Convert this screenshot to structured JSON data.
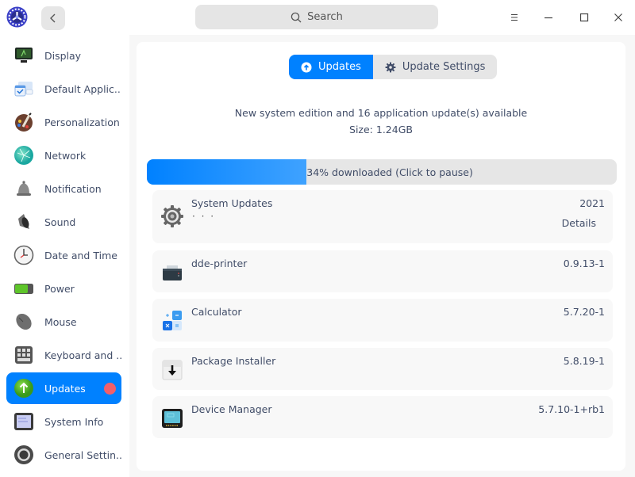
{
  "titlebar": {
    "app_icon": "deepin-control-center-logo-icon",
    "back_icon": "chevron-left-icon",
    "search_placeholder": "Search",
    "search_icon": "search-icon",
    "controls": [
      "menu-icon",
      "minimize-icon",
      "maximize-icon",
      "close-icon"
    ]
  },
  "sidebar": {
    "items": [
      {
        "label": "Display",
        "icon": "display-icon"
      },
      {
        "label": "Default Applic...",
        "icon": "default-applications-icon"
      },
      {
        "label": "Personalization",
        "icon": "personalization-palette-icon"
      },
      {
        "label": "Network",
        "icon": "network-globe-icon"
      },
      {
        "label": "Notification",
        "icon": "notification-bell-icon"
      },
      {
        "label": "Sound",
        "icon": "sound-speaker-icon"
      },
      {
        "label": "Date and Time",
        "icon": "clock-icon"
      },
      {
        "label": "Power",
        "icon": "battery-icon"
      },
      {
        "label": "Mouse",
        "icon": "mouse-icon"
      },
      {
        "label": "Keyboard and ...",
        "icon": "keyboard-icon"
      },
      {
        "label": "Updates",
        "icon": "update-arrow-icon",
        "active": true,
        "badge": true
      },
      {
        "label": "System Info",
        "icon": "system-info-icon"
      },
      {
        "label": "General Settin...",
        "icon": "general-settings-icon"
      }
    ]
  },
  "main": {
    "tabs": [
      {
        "label": "Updates",
        "icon": "upload-circle-icon",
        "active": true
      },
      {
        "label": "Update Settings",
        "icon": "gear-icon",
        "active": false
      }
    ],
    "summary_line1": "New system edition and 16 application update(s) available",
    "summary_line2": "Size: 1.24GB",
    "progress": {
      "percent": 34,
      "text": "34% downloaded (Click to pause)"
    },
    "updates": [
      {
        "name": "System Updates",
        "version": "2021",
        "subtext": "· · ·",
        "details": "Details",
        "icon": "system-gear-icon"
      },
      {
        "name": "dde-printer",
        "version": "0.9.13-1",
        "icon": "printer-icon"
      },
      {
        "name": "Calculator",
        "version": "5.7.20-1",
        "icon": "calculator-icon"
      },
      {
        "name": "Package Installer",
        "version": "5.8.19-1",
        "icon": "package-installer-icon"
      },
      {
        "name": "Device Manager",
        "version": "5.7.10-1+rb1",
        "icon": "device-manager-icon"
      }
    ]
  },
  "colors": {
    "accent": "#0081ff",
    "badge": "#f25f6a",
    "text": "#414d68"
  }
}
